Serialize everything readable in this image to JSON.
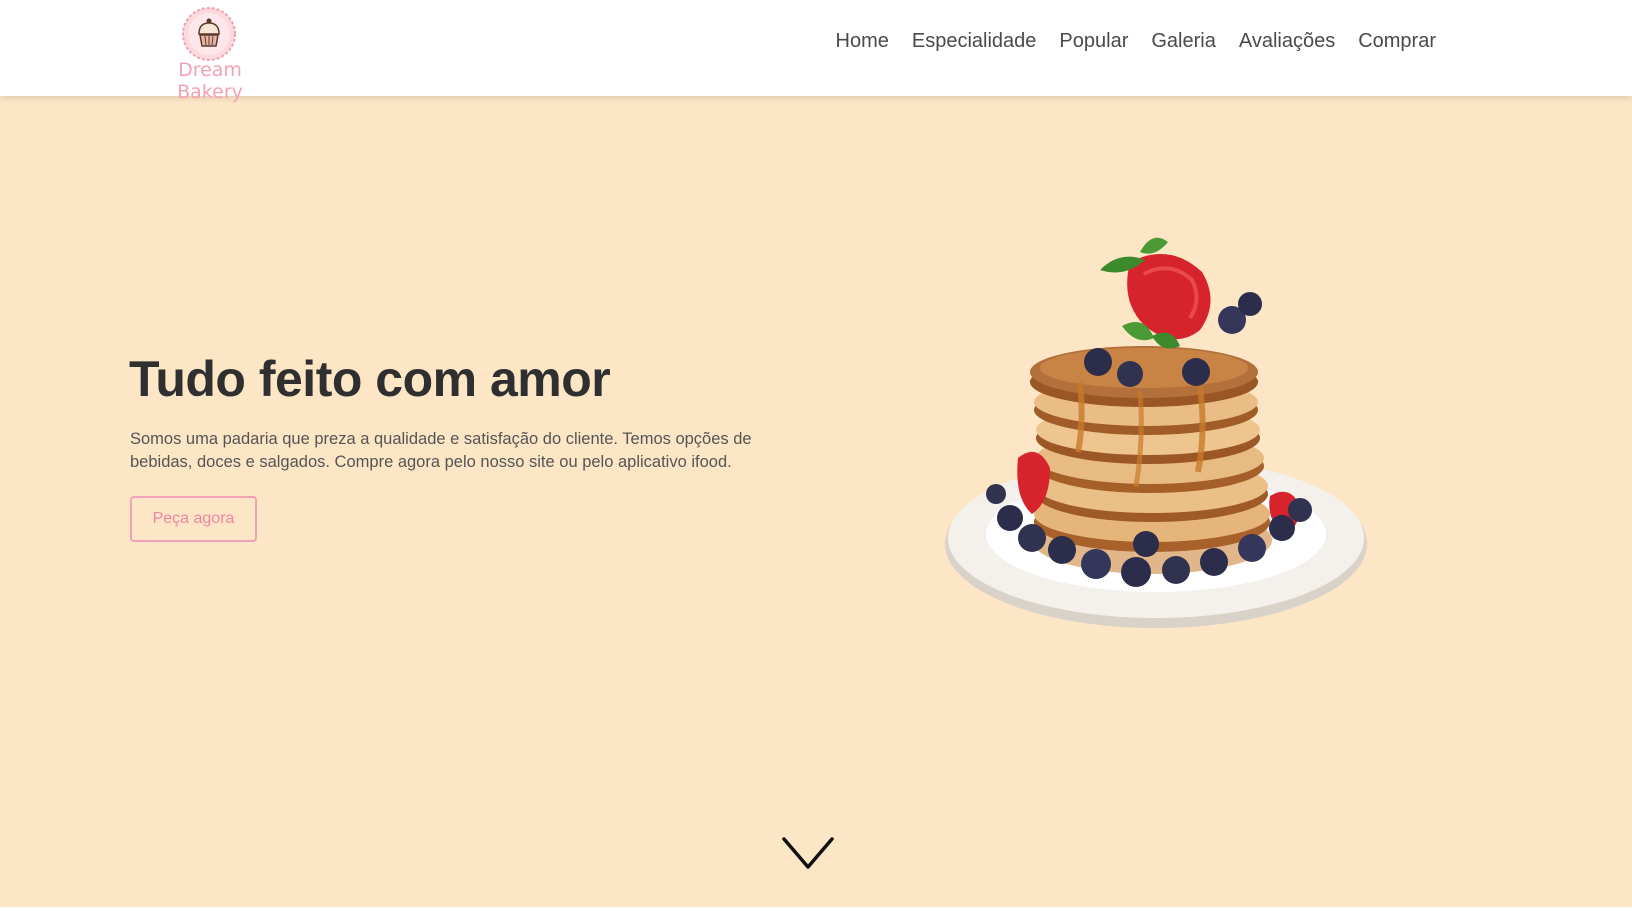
{
  "brand": {
    "name": "Dream Bakery",
    "logo_icon": "cupcake-icon"
  },
  "nav": {
    "items": [
      {
        "label": "Home"
      },
      {
        "label": "Especialidade"
      },
      {
        "label": "Popular"
      },
      {
        "label": "Galeria"
      },
      {
        "label": "Avaliações"
      },
      {
        "label": "Comprar"
      }
    ]
  },
  "hero": {
    "title": "Tudo feito com amor",
    "description": "Somos uma padaria que preza a qualidade e satisfação do cliente. Temos opções de bebidas, doces e salgados. Compre agora pelo nosso site ou pelo aplicativo ifood.",
    "button_label": "Peça agora",
    "image_icon": "pancake-stack-image",
    "scroll_icon": "chevron-down-icon"
  },
  "colors": {
    "background": "#fde6c6",
    "accent": "#f2a1b6",
    "heading": "#2f2f2f",
    "text": "#555555",
    "header": "#ffffff"
  }
}
